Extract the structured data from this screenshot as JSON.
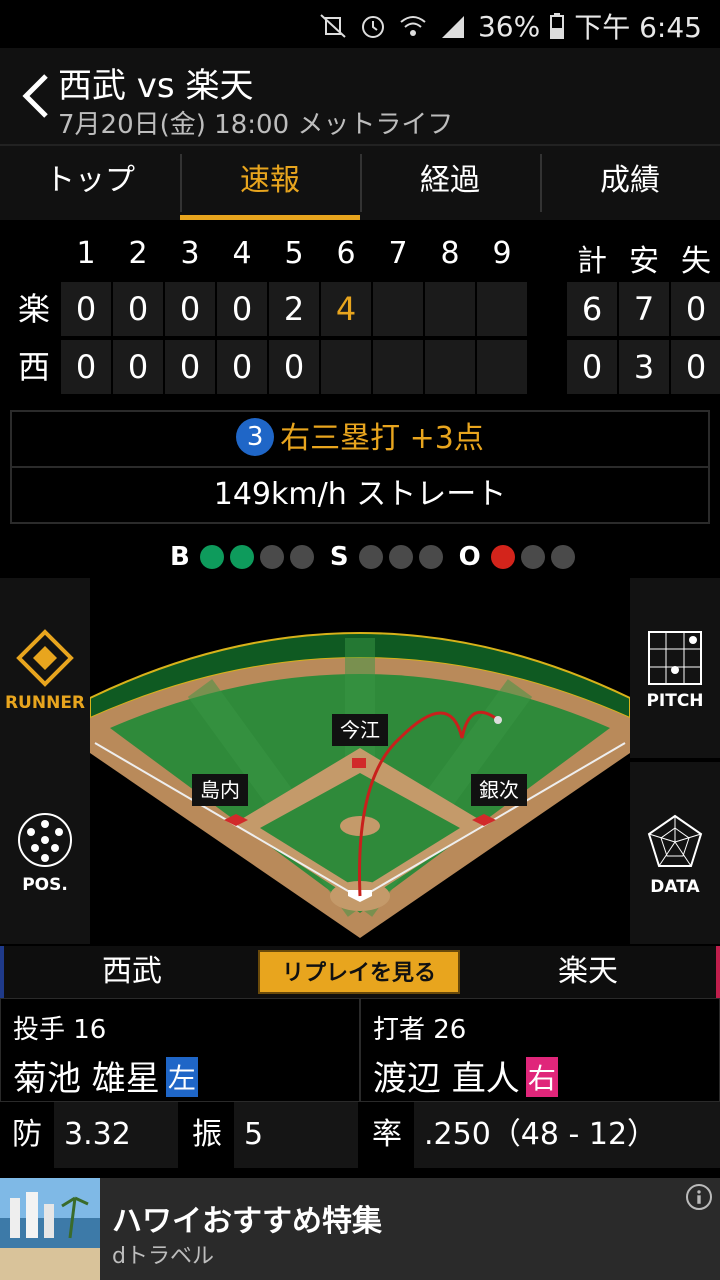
{
  "status_bar": {
    "battery": "36%",
    "time": "下午 6:45"
  },
  "header": {
    "title": "西武 vs 楽天",
    "subtitle": "7月20日(金) 18:00 メットライフ"
  },
  "tabs": [
    {
      "label": "トップ",
      "active": false
    },
    {
      "label": "速報",
      "active": true
    },
    {
      "label": "経過",
      "active": false
    },
    {
      "label": "成績",
      "active": false
    }
  ],
  "scoreboard": {
    "innings": [
      "1",
      "2",
      "3",
      "4",
      "5",
      "6",
      "7",
      "8",
      "9"
    ],
    "totals_headers": [
      "計",
      "安",
      "失"
    ],
    "teams": [
      {
        "label": "楽",
        "scores": [
          "0",
          "0",
          "0",
          "0",
          "2",
          "4",
          "",
          "",
          ""
        ],
        "totals": [
          "6",
          "7",
          "0"
        ]
      },
      {
        "label": "西",
        "scores": [
          "0",
          "0",
          "0",
          "0",
          "0",
          "",
          "",
          "",
          ""
        ],
        "totals": [
          "0",
          "3",
          "0"
        ]
      }
    ]
  },
  "play": {
    "number": "3",
    "result": "右三塁打 +3点",
    "pitch": "149km/h ストレート"
  },
  "count": {
    "b_label": "B",
    "s_label": "S",
    "o_label": "O",
    "balls": 2,
    "strikes": 0,
    "outs": 1
  },
  "field": {
    "runner_label": "RUNNER",
    "pos_label": "POS.",
    "pitch_label": "PITCH",
    "data_label": "DATA",
    "fielders": [
      "今江",
      "島内",
      "銀次"
    ]
  },
  "teambar": {
    "home": "西武",
    "away": "楽天",
    "replay_label": "リプレイを見る"
  },
  "pitcher": {
    "role": "投手 16",
    "name": "菊池 雄星",
    "hand": "左",
    "hand_color": "#1f66c7"
  },
  "batter": {
    "role": "打者 26",
    "name": "渡辺 直人",
    "hand": "右",
    "hand_color": "#e0267a"
  },
  "stats": {
    "era_label": "防",
    "era": "3.32",
    "k_label": "振",
    "k": "5",
    "avg_label": "率",
    "avg": ".250（48 - 12）"
  },
  "ad": {
    "title": "ハワイおすすめ特集",
    "sponsor": "dトラベル"
  },
  "colors": {
    "accent": "#e8a51e",
    "ball_green": "#0e9b5c",
    "out_red": "#d3241b"
  }
}
